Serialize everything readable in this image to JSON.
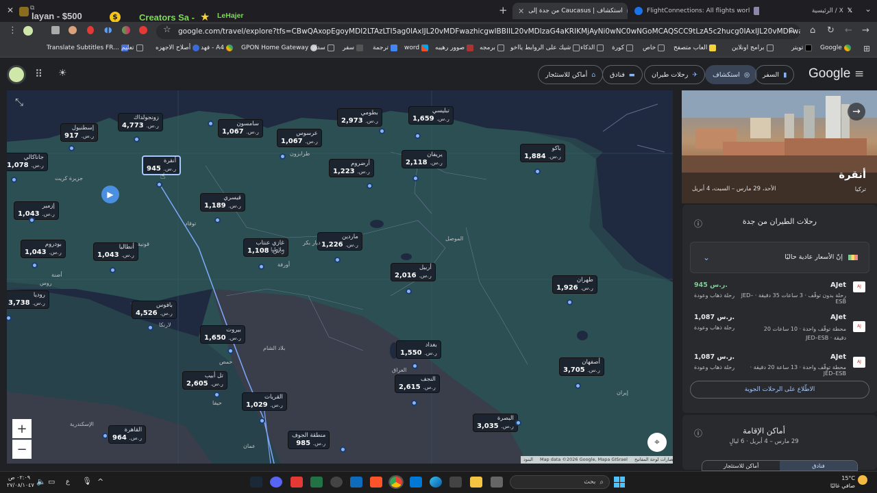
{
  "tabs": [
    {
      "title": "الرئيسية / X",
      "active": false
    },
    {
      "title": "FlightConnections: All flights worl",
      "active": false
    },
    {
      "title": "من جدة إلى Caucasus | استكشاف",
      "active": true
    }
  ],
  "extensions": {
    "layan": "layan - $500",
    "creators": "Creators Sa -",
    "lehajer": "LeHajer"
  },
  "address": {
    "url": "google.com/travel/explore?tfs=CBwQAxopEgoyMDI2LTAzLTI5ag0IAxIJL20vMDFwazhicgwIBBIIL20vMDlzaG4aKRIKMjAyNi0wNC0wNGoMCAQSCC9tLzA5c2hucg0IAxIJL20vMDFwazhiQAFIAXABggELCP..."
  },
  "bookmarks": [
    "Google",
    "تويتر",
    "برامج اونلاين",
    "العاب متصفح",
    "خاص",
    "كورة",
    "الذكاء",
    "شيك على الروابط يااخو",
    "برمجه",
    "صوور رهيبه",
    "word",
    "ترجمة",
    "سفر",
    "سداد",
    "GPON Home Gateway",
    "فهد - A4",
    "أصلاح الاجهزه",
    "تعليم",
    "Translate Subtitles FR..."
  ],
  "header": {
    "logo": "Google",
    "chips": {
      "travel": "السفر",
      "explore": "استكشاف",
      "flights": "رحلات طيران",
      "hotels": "فنادق",
      "vacation": "أماكن للاستئجار"
    }
  },
  "map": {
    "markers": [
      {
        "city": "إسطنبول",
        "price": "917"
      },
      {
        "city": "زونجولداك",
        "price": "4,773"
      },
      {
        "city": "سامسون",
        "price": "1,067"
      },
      {
        "city": "عرسوس",
        "price": "1,067"
      },
      {
        "city": "بطومي",
        "price": "2,973"
      },
      {
        "city": "تبليسي",
        "price": "1,659"
      },
      {
        "city": "جاناكالي",
        "price": "1,078"
      },
      {
        "city": "أنقرة",
        "price": "945"
      },
      {
        "city": "أرضروم",
        "price": "1,223"
      },
      {
        "city": "يريفان",
        "price": "2,118"
      },
      {
        "city": "باكو",
        "price": "1,884"
      },
      {
        "city": "إزمير",
        "price": "1,043"
      },
      {
        "city": "قيسري",
        "price": "1,189"
      },
      {
        "city": "بودروم",
        "price": "1,043"
      },
      {
        "city": "أنطاليا",
        "price": "1,043"
      },
      {
        "city": "غازي عنتاب",
        "price": "1,108"
      },
      {
        "city": "ماردين",
        "price": "1,226"
      },
      {
        "city": "أربيل",
        "price": "2,016"
      },
      {
        "city": "طهران",
        "price": "1,926"
      },
      {
        "city": "بافوس",
        "price": "4,526"
      },
      {
        "city": "روديا",
        "price": "3,738"
      },
      {
        "city": "بيروت",
        "price": "1,650"
      },
      {
        "city": "بغداد",
        "price": "1,550"
      },
      {
        "city": "أصفهان",
        "price": "3,705"
      },
      {
        "city": "تل أبيب",
        "price": "2,605"
      },
      {
        "city": "النجف",
        "price": "2,615"
      },
      {
        "city": "القريات",
        "price": "1,029"
      },
      {
        "city": "القاهرة",
        "price": "964"
      },
      {
        "city": "منطقة الجوف",
        "price": "985"
      },
      {
        "city": "البصرة",
        "price": "3,035"
      }
    ],
    "currency": "ر.س.",
    "places": [
      "طرابزون",
      "توقاد",
      "ملاطيا",
      "ديار بكر",
      "قونية",
      "أورفة",
      "أضنة",
      "بلاد الشام",
      "العراق",
      "إيران",
      "الإسكندرية",
      "حمص",
      "الموصل",
      "عمان",
      "جزيرة كريت",
      "لارنكا",
      "روس",
      "حيفا"
    ],
    "attribution": "Map data ©2026 Google, Mapa GISrael",
    "terms": "اختصارات لوحة المفاتيح",
    "terms2": "البنود"
  },
  "destination": {
    "name": "أنقرة",
    "country": "تركيا",
    "dates": "الأحد، 29 مارس – السبت، 4 أبريل"
  },
  "flights_card": {
    "title": "رحلات الطيران من جدة",
    "price_notice": "إنّ الأسعار عادية حاليًا",
    "see_all": "الاطّلاع على الرحلات الجوية",
    "items": [
      {
        "airline": "AJet",
        "price": "945 ر.س.",
        "price_color": "#81c995",
        "info": "رحلة بدون توقّف · 3 ساعات 35 دقيقة · JED–ESB",
        "trip": "رحلة ذهاب وعودة"
      },
      {
        "airline": "AJet",
        "price": "1,087 ر.س.",
        "price_color": "#e8eaed",
        "info": "محطة توقّف واحدة · 10 ساعات 20 دقيقة · JED–ESB",
        "trip": "رحلة ذهاب وعودة"
      },
      {
        "airline": "AJet",
        "price": "1,087 ر.س.",
        "price_color": "#e8eaed",
        "info": "محطة توقّف واحدة · 13 ساعة 20 دقيقة · JED–ESB",
        "trip": "رحلة ذهاب وعودة"
      }
    ]
  },
  "stays_card": {
    "title": "أماكن الإقامة",
    "dates": "29 مارس – 4 أبريل · 6 ليالٍ",
    "tab_hotels": "فنادق",
    "tab_vacation": "أماكن للاستئجار"
  },
  "taskbar": {
    "search": "بحث",
    "time": "٠٢:٠٩ ص",
    "date": "٢٧/٠٨/١٠٤٧",
    "lang": "ع",
    "weather_temp": "15°C",
    "weather_desc": "صافي غالبًا"
  },
  "colors": {
    "accent": "#8ab4f8",
    "map_bg": "#243b43",
    "price_good": "#81c995"
  }
}
